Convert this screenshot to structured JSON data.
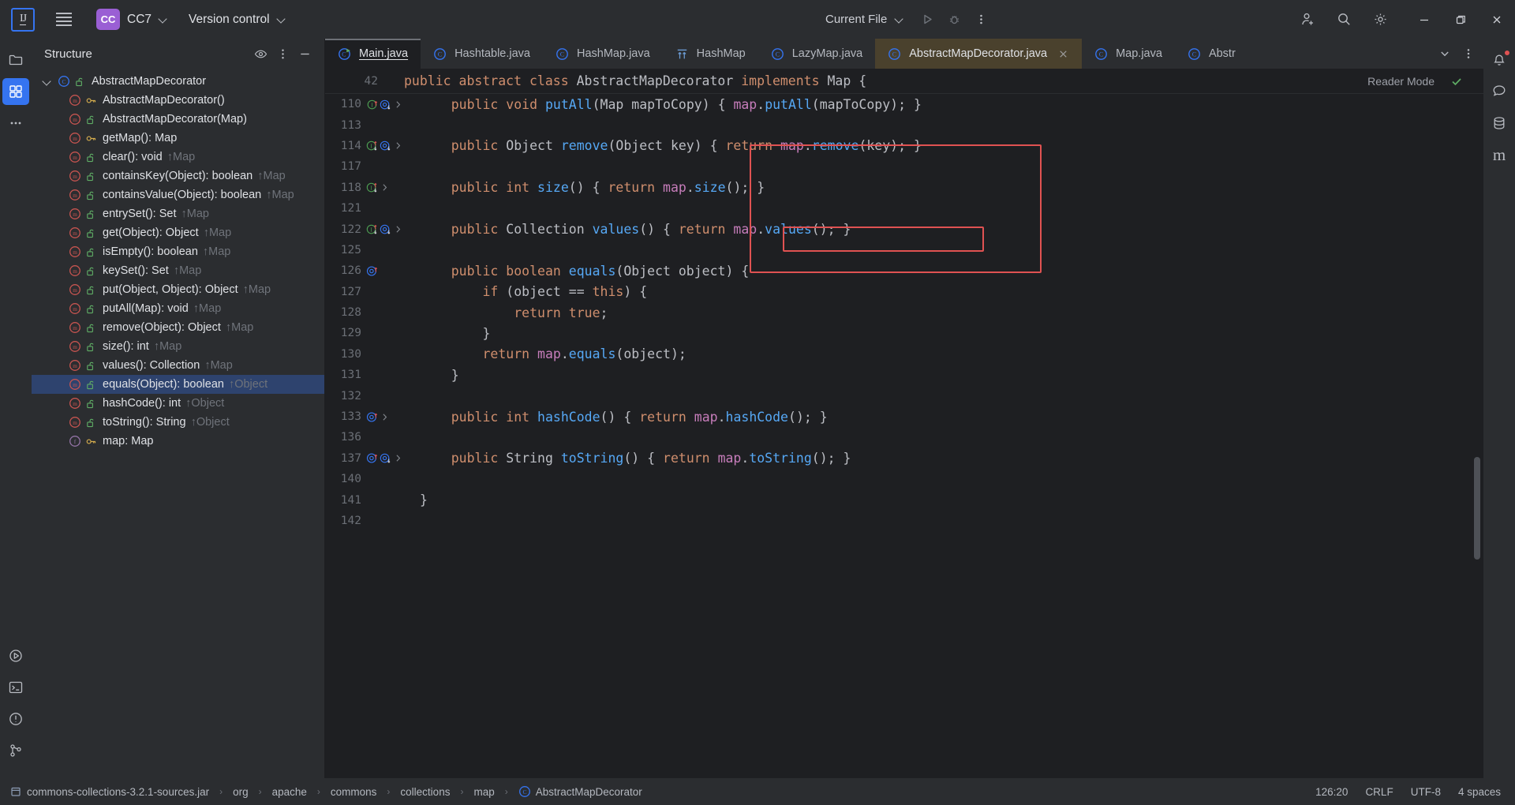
{
  "titlebar": {
    "logo": "intellij-idea-logo",
    "menu_icon": "hamburger-menu-icon",
    "project_badge": "CC",
    "project_name": "CC7",
    "vcs_label": "Version control",
    "run_config": "Current File",
    "run_icon": "run-icon",
    "debug_icon": "debug-icon",
    "more_icon": "more-vertical-icon",
    "account_icon": "account-add-icon",
    "search_icon": "search-icon",
    "settings_icon": "settings-gear-icon",
    "minimize": "minimize-icon",
    "maximize": "maximize-icon",
    "close": "close-icon"
  },
  "left_rail": {
    "items": [
      {
        "name": "project-tool-window",
        "icon": "folder-icon",
        "active": false
      },
      {
        "name": "structure-tool-window",
        "icon": "structure-icon",
        "active": true
      },
      {
        "name": "more-tool-windows",
        "icon": "more-horizontal-icon",
        "active": false
      }
    ],
    "bottom_items": [
      {
        "name": "run-tool-window",
        "icon": "run-circle-icon"
      },
      {
        "name": "terminal-tool-window",
        "icon": "terminal-icon"
      },
      {
        "name": "problems-tool-window",
        "icon": "warning-circle-icon"
      },
      {
        "name": "version-control-tool-window",
        "icon": "git-branch-icon"
      }
    ]
  },
  "right_rail": {
    "items": [
      {
        "name": "notifications",
        "icon": "bell-icon"
      },
      {
        "name": "ai-assistant",
        "icon": "ai-icon"
      },
      {
        "name": "database",
        "icon": "database-icon"
      },
      {
        "name": "maven",
        "icon": "maven-m-icon"
      }
    ]
  },
  "structure": {
    "title": "Structure",
    "header_icons": [
      "eye-icon",
      "more-vertical-icon",
      "hide-icon"
    ],
    "tree": [
      {
        "label": "AbstractMapDecorator",
        "icon": "class-icon",
        "vis": "public-unlock-icon",
        "depth": 0,
        "expanded": true,
        "inherited": "",
        "selected": false
      },
      {
        "label": "AbstractMapDecorator()",
        "icon": "method-icon",
        "vis": "protected-key-icon",
        "depth": 1,
        "inherited": "",
        "selected": false
      },
      {
        "label": "AbstractMapDecorator(Map)",
        "icon": "method-icon",
        "vis": "public-unlock-icon",
        "depth": 1,
        "inherited": "",
        "selected": false
      },
      {
        "label": "getMap(): Map",
        "icon": "method-icon",
        "vis": "protected-key-icon",
        "depth": 1,
        "inherited": "",
        "selected": false
      },
      {
        "label": "clear(): void",
        "icon": "method-icon",
        "vis": "public-unlock-icon",
        "depth": 1,
        "inherited": "↑Map",
        "selected": false
      },
      {
        "label": "containsKey(Object): boolean",
        "icon": "method-icon",
        "vis": "public-unlock-icon",
        "depth": 1,
        "inherited": "↑Map",
        "selected": false
      },
      {
        "label": "containsValue(Object): boolean",
        "icon": "method-icon",
        "vis": "public-unlock-icon",
        "depth": 1,
        "inherited": "↑Map",
        "selected": false
      },
      {
        "label": "entrySet(): Set",
        "icon": "method-icon",
        "vis": "public-unlock-icon",
        "depth": 1,
        "inherited": "↑Map",
        "selected": false
      },
      {
        "label": "get(Object): Object",
        "icon": "method-icon",
        "vis": "public-unlock-icon",
        "depth": 1,
        "inherited": "↑Map",
        "selected": false
      },
      {
        "label": "isEmpty(): boolean",
        "icon": "method-icon",
        "vis": "public-unlock-icon",
        "depth": 1,
        "inherited": "↑Map",
        "selected": false
      },
      {
        "label": "keySet(): Set",
        "icon": "method-icon",
        "vis": "public-unlock-icon",
        "depth": 1,
        "inherited": "↑Map",
        "selected": false
      },
      {
        "label": "put(Object, Object): Object",
        "icon": "method-icon",
        "vis": "public-unlock-icon",
        "depth": 1,
        "inherited": "↑Map",
        "selected": false
      },
      {
        "label": "putAll(Map): void",
        "icon": "method-icon",
        "vis": "public-unlock-icon",
        "depth": 1,
        "inherited": "↑Map",
        "selected": false
      },
      {
        "label": "remove(Object): Object",
        "icon": "method-icon",
        "vis": "public-unlock-icon",
        "depth": 1,
        "inherited": "↑Map",
        "selected": false
      },
      {
        "label": "size(): int",
        "icon": "method-icon",
        "vis": "public-unlock-icon",
        "depth": 1,
        "inherited": "↑Map",
        "selected": false
      },
      {
        "label": "values(): Collection",
        "icon": "method-icon",
        "vis": "public-unlock-icon",
        "depth": 1,
        "inherited": "↑Map",
        "selected": false
      },
      {
        "label": "equals(Object): boolean",
        "icon": "method-icon",
        "vis": "public-unlock-icon",
        "depth": 1,
        "inherited": "↑Object",
        "selected": true
      },
      {
        "label": "hashCode(): int",
        "icon": "method-icon",
        "vis": "public-unlock-icon",
        "depth": 1,
        "inherited": "↑Object",
        "selected": false
      },
      {
        "label": "toString(): String",
        "icon": "method-icon",
        "vis": "public-unlock-icon",
        "depth": 1,
        "inherited": "↑Object",
        "selected": false
      },
      {
        "label": "map: Map",
        "icon": "field-icon",
        "vis": "protected-key-icon",
        "depth": 1,
        "inherited": "",
        "selected": false
      }
    ]
  },
  "tabs": {
    "items": [
      {
        "label": "Main.java",
        "icon": "java-runnable-class-icon",
        "state": "current"
      },
      {
        "label": "Hashtable.java",
        "icon": "java-class-icon",
        "state": "normal"
      },
      {
        "label": "HashMap.java",
        "icon": "java-class-icon",
        "state": "normal"
      },
      {
        "label": "HashMap",
        "icon": "type-hierarchy-icon",
        "state": "normal"
      },
      {
        "label": "LazyMap.java",
        "icon": "java-class-icon",
        "state": "normal"
      },
      {
        "label": "AbstractMapDecorator.java",
        "icon": "java-class-icon",
        "state": "selected",
        "closable": true
      },
      {
        "label": "Map.java",
        "icon": "java-class-icon",
        "state": "normal"
      },
      {
        "label": "Abstr",
        "icon": "java-class-icon",
        "state": "normal"
      }
    ],
    "overflow_icon": "chevron-down-icon",
    "options_icon": "more-vertical-icon"
  },
  "editor": {
    "sticky_line_number": "42",
    "sticky_code": "public abstract class AbstractMapDecorator implements Map {",
    "reader_mode_label": "Reader Mode",
    "reader_check_icon": "checkmark-icon",
    "lines": [
      {
        "num": "110",
        "gutter": [
          "impl-up-icon",
          "override-down-icon",
          "fold-icon"
        ],
        "code": "    public void putAll(Map mapToCopy) { map.putAll(mapToCopy); }"
      },
      {
        "num": "113",
        "gutter": [],
        "code": ""
      },
      {
        "num": "114",
        "gutter": [
          "impl-updown-icon",
          "override-down-icon",
          "fold-icon"
        ],
        "code": "    public Object remove(Object key) { return map.remove(key); }"
      },
      {
        "num": "117",
        "gutter": [],
        "code": ""
      },
      {
        "num": "118",
        "gutter": [
          "impl-updown-icon",
          "fold-icon"
        ],
        "code": "    public int size() { return map.size(); }"
      },
      {
        "num": "121",
        "gutter": [],
        "code": ""
      },
      {
        "num": "122",
        "gutter": [
          "impl-updown-icon",
          "override-down-icon",
          "fold-icon"
        ],
        "code": "    public Collection values() { return map.values(); }"
      },
      {
        "num": "125",
        "gutter": [],
        "code": ""
      },
      {
        "num": "126",
        "gutter": [
          "override-up-icon"
        ],
        "code": "    public boolean equals(Object object) {"
      },
      {
        "num": "127",
        "gutter": [],
        "code": "        if (object == this) {"
      },
      {
        "num": "128",
        "gutter": [],
        "code": "            return true;"
      },
      {
        "num": "129",
        "gutter": [],
        "code": "        }"
      },
      {
        "num": "130",
        "gutter": [],
        "code": "        return map.equals(object);"
      },
      {
        "num": "131",
        "gutter": [],
        "code": "    }"
      },
      {
        "num": "132",
        "gutter": [],
        "code": ""
      },
      {
        "num": "133",
        "gutter": [
          "override-up-icon",
          "fold-icon"
        ],
        "code": "    public int hashCode() { return map.hashCode(); }"
      },
      {
        "num": "136",
        "gutter": [],
        "code": ""
      },
      {
        "num": "137",
        "gutter": [
          "override-up-icon",
          "override-down-icon",
          "fold-icon"
        ],
        "code": "    public String toString() { return map.toString(); }"
      },
      {
        "num": "140",
        "gutter": [],
        "code": ""
      },
      {
        "num": "141",
        "gutter": [],
        "code": "}"
      },
      {
        "num": "142",
        "gutter": [],
        "code": ""
      }
    ],
    "highlight_color": "#e05252"
  },
  "status": {
    "jar_icon": "jar-icon",
    "breadcrumb": [
      {
        "label": "commons-collections-3.2.1-sources.jar",
        "icon": "jar-icon"
      },
      {
        "label": "org",
        "icon": ""
      },
      {
        "label": "apache",
        "icon": ""
      },
      {
        "label": "commons",
        "icon": ""
      },
      {
        "label": "collections",
        "icon": ""
      },
      {
        "label": "map",
        "icon": ""
      },
      {
        "label": "AbstractMapDecorator",
        "icon": "class-icon"
      }
    ],
    "caret": "126:20",
    "line_sep": "CRLF",
    "encoding": "UTF-8",
    "indent": "4 spaces"
  },
  "colors": {
    "accent": "#3574f0",
    "badge": "#9a5fd4",
    "selected_tab_bg": "#4a412d",
    "selection_blue": "#2e436e",
    "highlight_red": "#e05252"
  }
}
